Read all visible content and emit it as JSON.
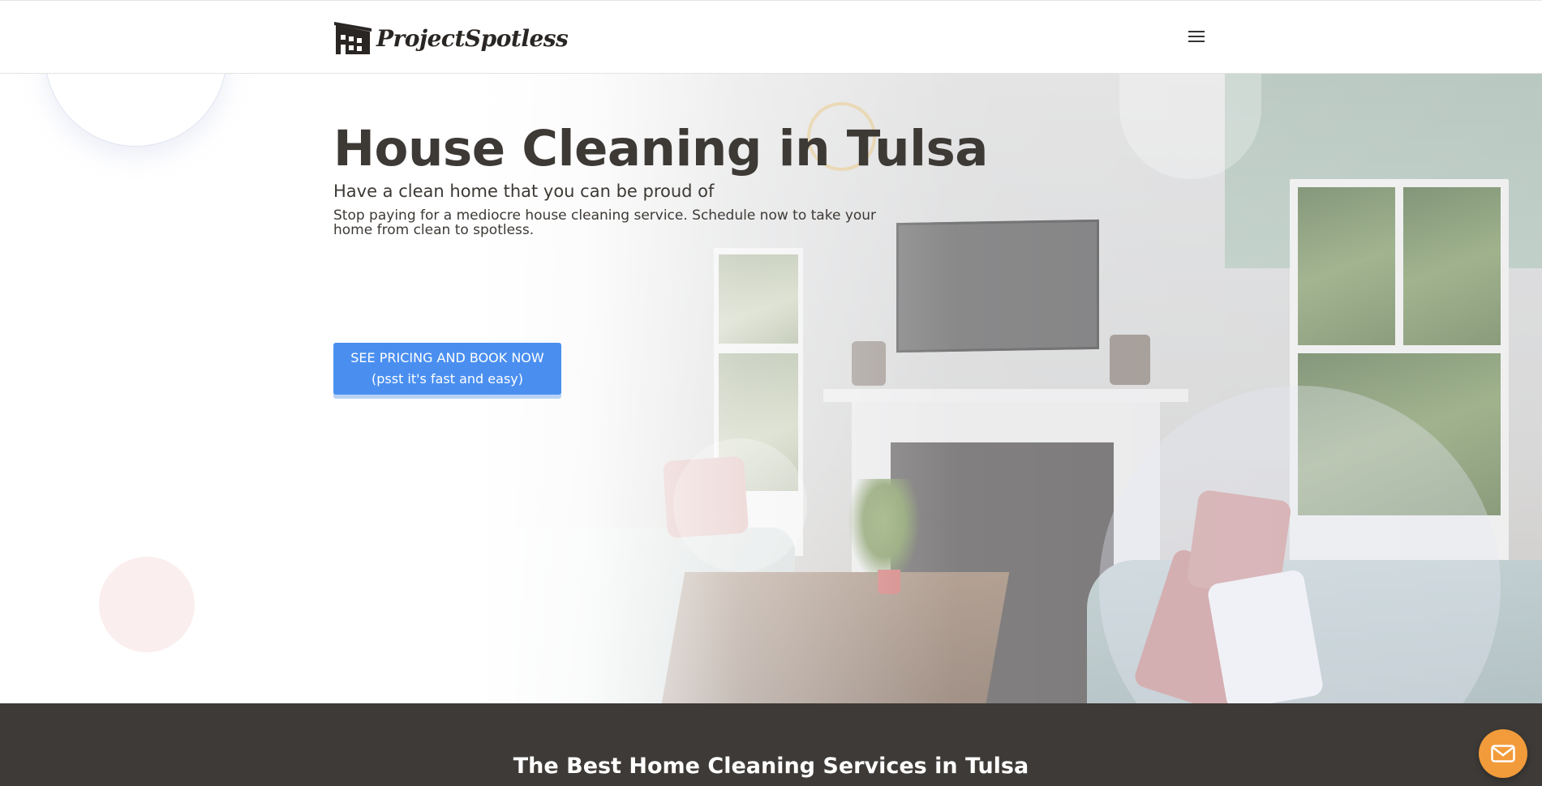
{
  "header": {
    "logo_text": "ProjectSpotless",
    "menu_icon": "hamburger-menu-icon"
  },
  "hero": {
    "title": "House Cleaning in Tulsa",
    "subtitle": "Have a clean home that you can be proud of",
    "description": "Stop paying for a mediocre house cleaning service. Schedule now to take your home from clean to spotless.",
    "cta_line1": "SEE PRICING AND BOOK NOW",
    "cta_line2": "(psst it's fast and easy)"
  },
  "band": {
    "title": "The Best Home Cleaning Services in Tulsa"
  },
  "chat": {
    "icon": "envelope-icon"
  },
  "colors": {
    "accent": "#4a8ff0",
    "dark_band": "#3d3a37",
    "chat_button": "#f29b3a",
    "text": "#3d3935"
  }
}
